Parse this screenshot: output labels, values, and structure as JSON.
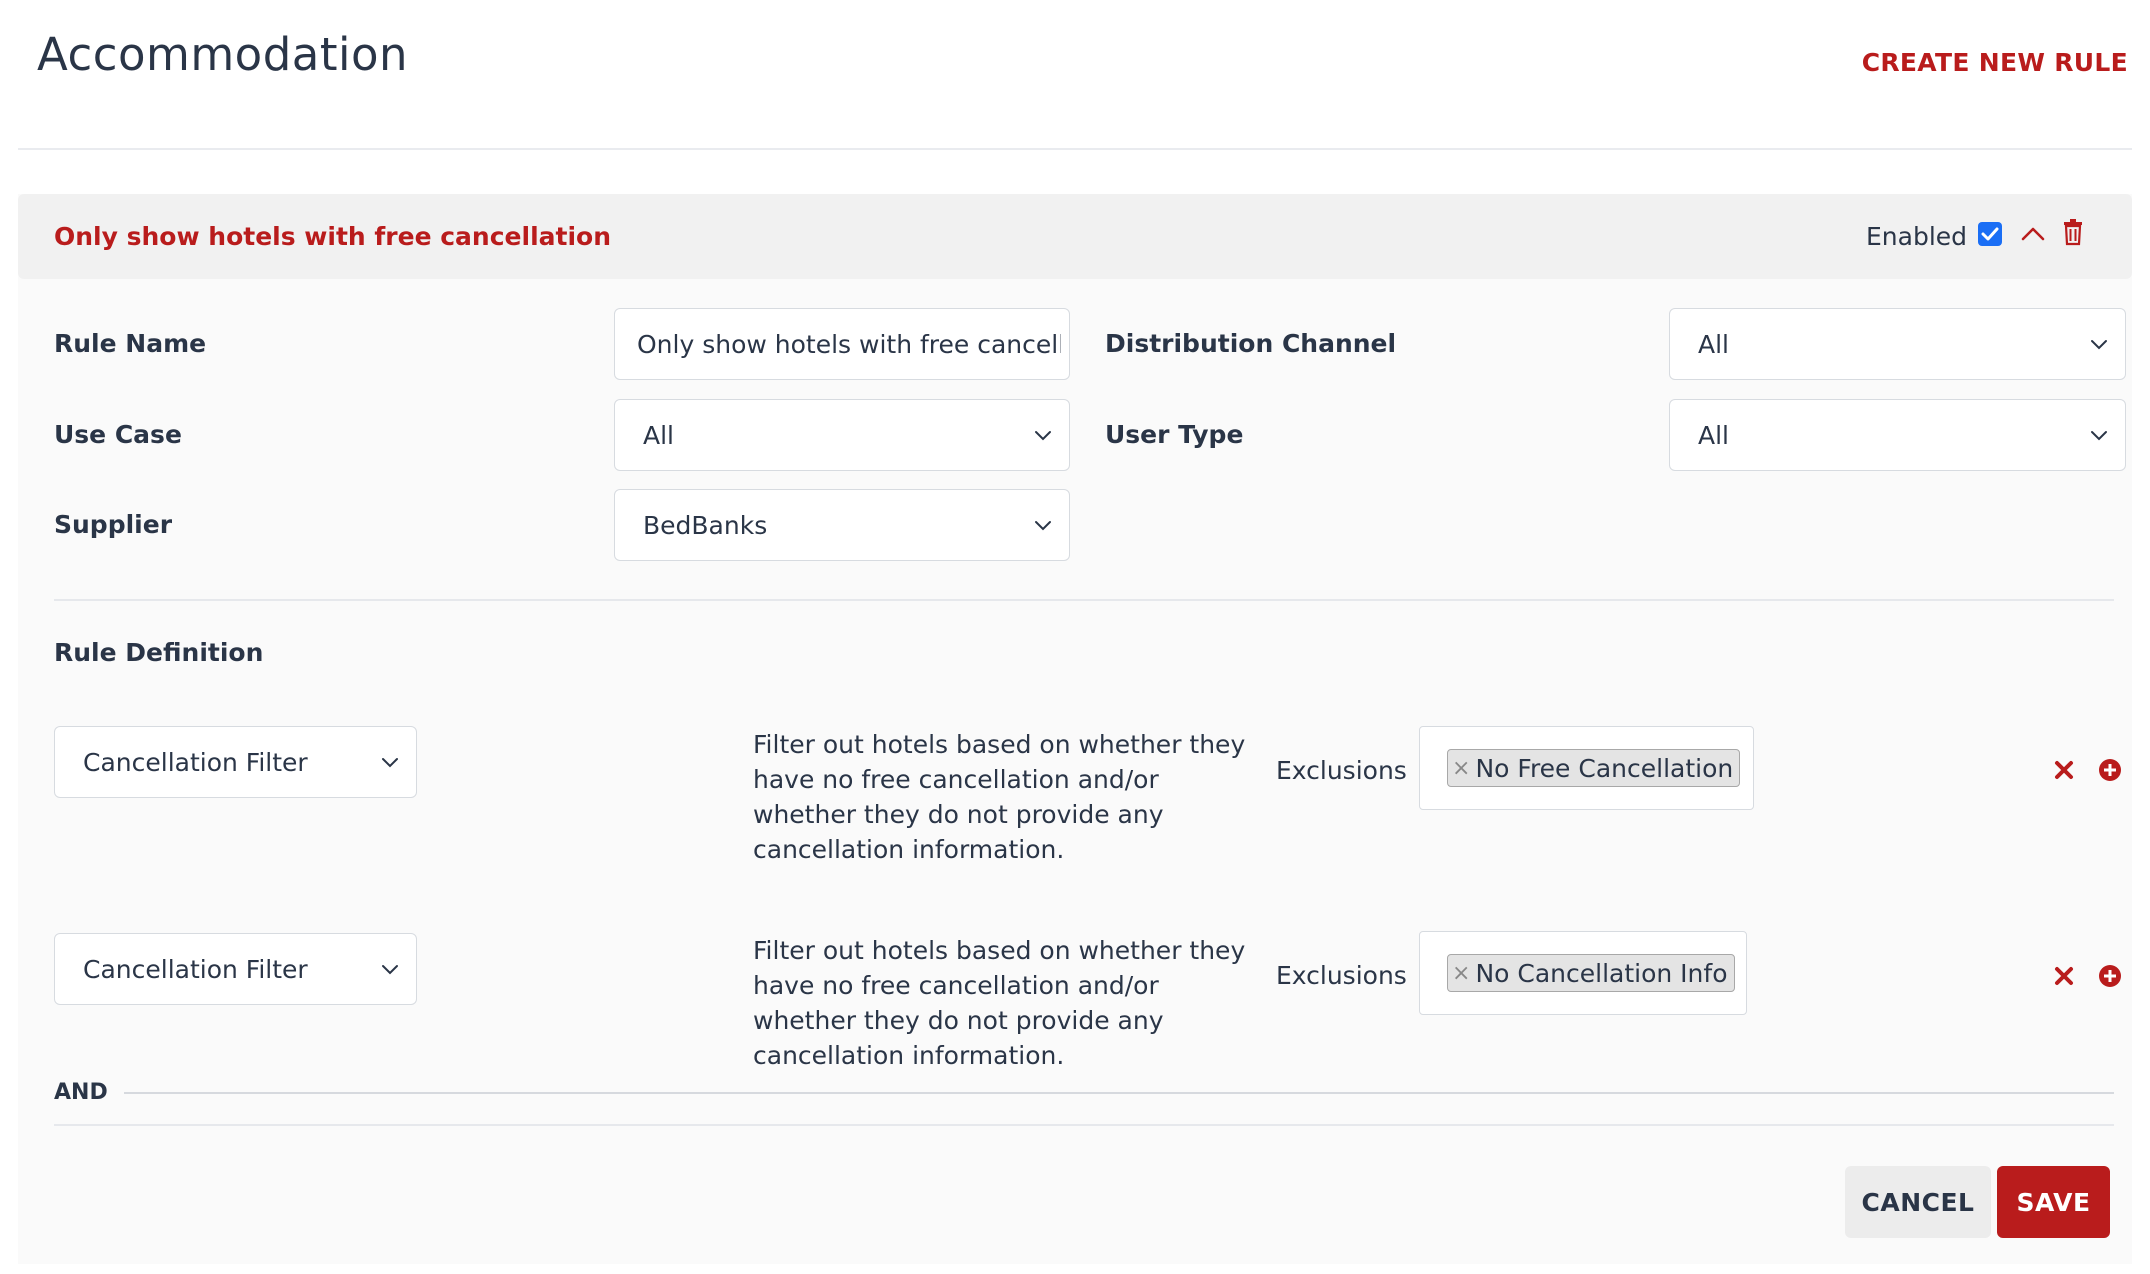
{
  "header": {
    "title": "Accommodation",
    "create_label": "CREATE NEW RULE"
  },
  "rule": {
    "title": "Only show hotels with free cancellation",
    "enabled_label": "Enabled",
    "enabled": true,
    "form": {
      "rule_name_label": "Rule Name",
      "rule_name_value": "Only show hotels with free cancellation",
      "distribution_channel_label": "Distribution Channel",
      "distribution_channel_value": "All",
      "use_case_label": "Use Case",
      "use_case_value": "All",
      "user_type_label": "User Type",
      "user_type_value": "All",
      "supplier_label": "Supplier",
      "supplier_value": "BedBanks"
    },
    "definition": {
      "title": "Rule Definition",
      "conjunction": "AND",
      "conditions": [
        {
          "filter": "Cancellation Filter",
          "description": "Filter out hotels based on whether they have no free cancellation and/or whether they do not provide any cancellation information.",
          "exclusions_label": "Exclusions",
          "tag_remove": "×",
          "tag": "No Free Cancellation"
        },
        {
          "filter": "Cancellation Filter",
          "description": "Filter out hotels based on whether they have no free cancellation and/or whether they do not provide any cancellation information.",
          "exclusions_label": "Exclusions",
          "tag_remove": "×",
          "tag": "No Cancellation Info"
        }
      ]
    },
    "actions": {
      "cancel_label": "CANCEL",
      "save_label": "SAVE"
    }
  },
  "colors": {
    "accent": "#b91c1c",
    "checkbox": "#1a6ef5",
    "text": "#2a3547"
  },
  "icons": {
    "collapse": "chevron-up-icon",
    "delete": "trash-icon",
    "dropdown": "chevron-down-icon",
    "remove_row": "close-icon",
    "add_row": "plus-circle-icon"
  }
}
